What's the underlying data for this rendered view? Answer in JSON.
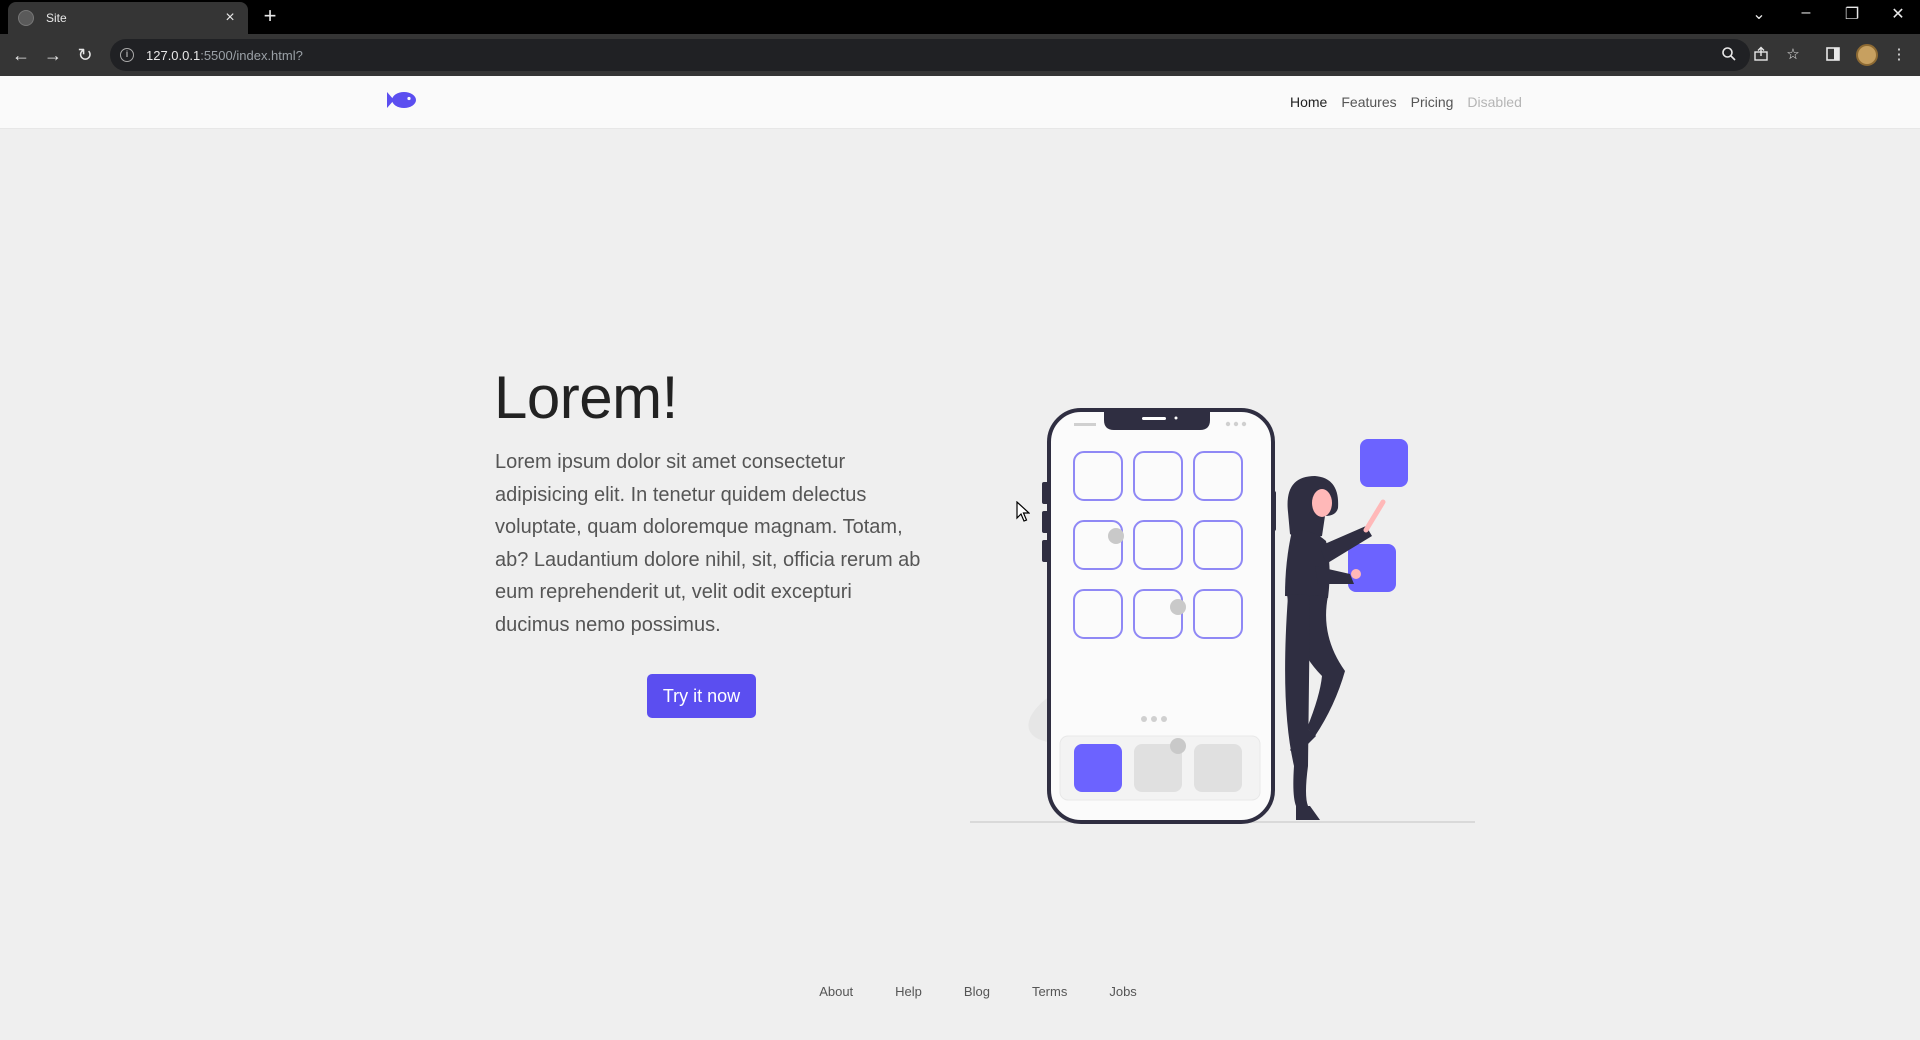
{
  "browser": {
    "tab_title": "Site",
    "tab_close": "×",
    "new_tab": "+",
    "url_host": "127.0.0.1",
    "url_path": ":5500/index.html?",
    "window_controls": [
      "⌄",
      "–",
      "❐",
      "✕"
    ]
  },
  "site": {
    "nav": {
      "links": [
        {
          "label": "Home",
          "state": "active"
        },
        {
          "label": "Features",
          "state": "normal"
        },
        {
          "label": "Pricing",
          "state": "normal"
        },
        {
          "label": "Disabled",
          "state": "disabled"
        }
      ]
    },
    "hero": {
      "title": "Lorem!",
      "text": "Lorem ipsum dolor sit amet consectetur adipisicing elit. In tenetur quidem delectus voluptate, quam doloremque magnam. Totam, ab? Laudantium dolore nihil, sit, officia rerum ab eum reprehenderit ut, velit odit excepturi ducimus nemo possimus.",
      "cta_label": "Try it now"
    },
    "footer": {
      "links": [
        "About",
        "Help",
        "Blog",
        "Terms",
        "Jobs"
      ]
    }
  },
  "colors": {
    "accent": "#5b4ef0",
    "illustration_accent": "#6c63ff",
    "dark": "#2f2e41"
  }
}
